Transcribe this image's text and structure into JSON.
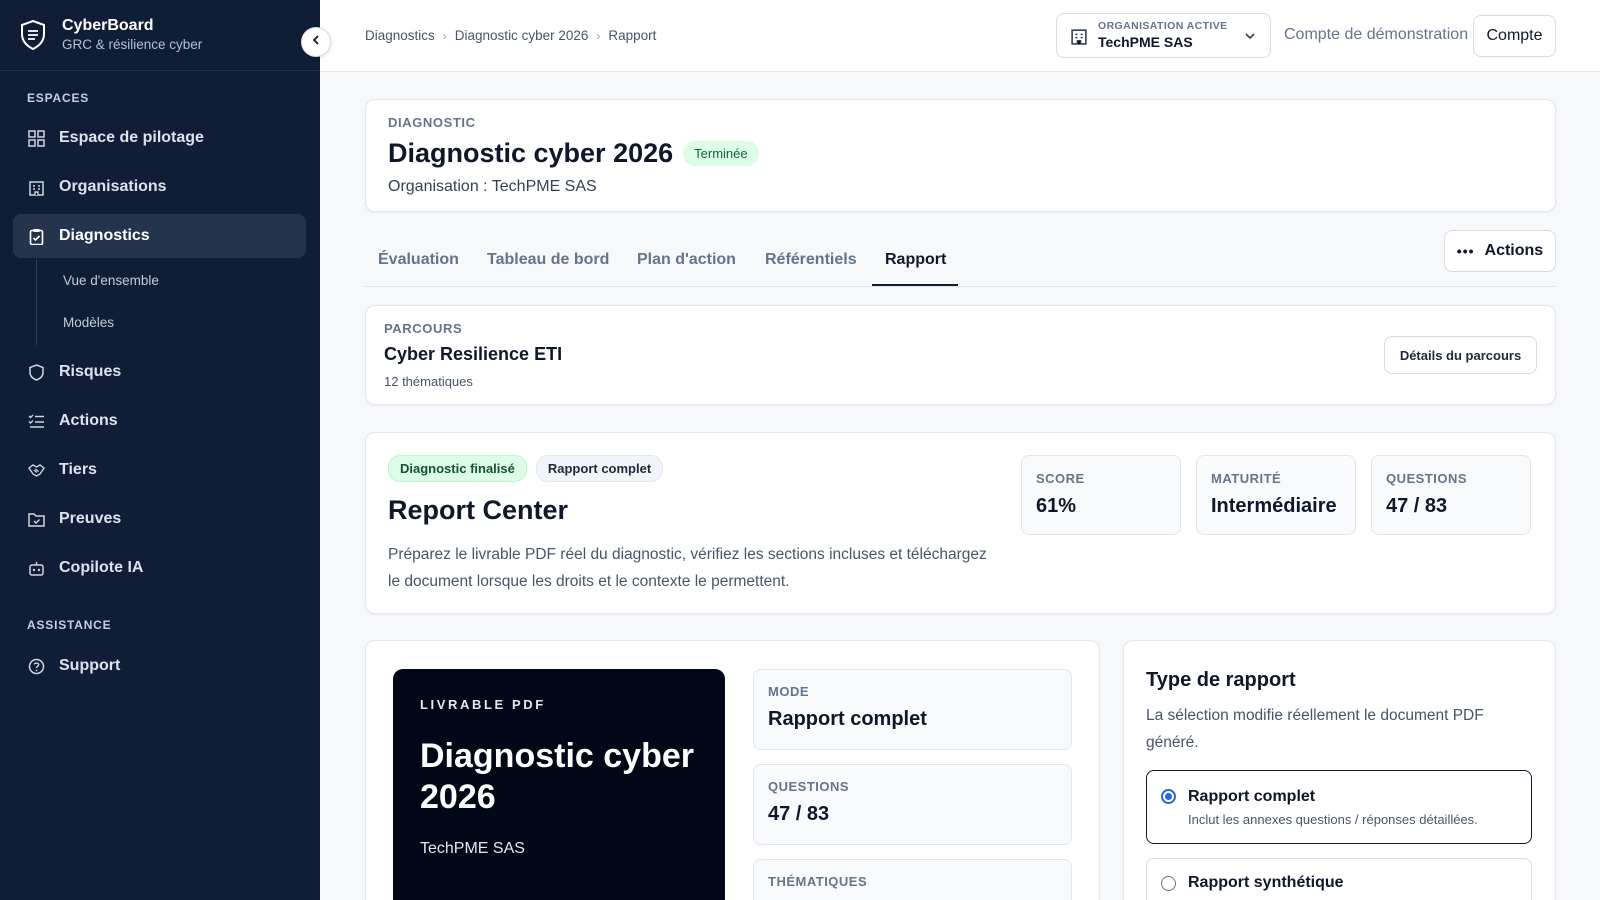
{
  "app": {
    "name": "CyberBoard",
    "tagline": "GRC & résilience cyber"
  },
  "sidebar": {
    "section_spaces": "ESPACES",
    "items": [
      {
        "label": "Espace de pilotage",
        "icon": "dashboard-icon"
      },
      {
        "label": "Organisations",
        "icon": "building-icon"
      },
      {
        "label": "Diagnostics",
        "icon": "clipboard-icon",
        "active": true
      },
      {
        "label": "Risques",
        "icon": "shield-icon"
      },
      {
        "label": "Actions",
        "icon": "checklist-icon"
      },
      {
        "label": "Tiers",
        "icon": "handshake-icon"
      },
      {
        "label": "Preuves",
        "icon": "folder-check-icon"
      },
      {
        "label": "Copilote IA",
        "icon": "bot-icon"
      }
    ],
    "subitems": [
      "Vue d'ensemble",
      "Modèles"
    ],
    "section_assistance": "ASSISTANCE",
    "support": "Support"
  },
  "topbar": {
    "breadcrumb": [
      "Diagnostics",
      "Diagnostic cyber 2026",
      "Rapport"
    ],
    "org_label": "ORGANISATION ACTIVE",
    "org_value": "TechPME SAS",
    "demo": "Compte de démonstration",
    "account": "Compte"
  },
  "header": {
    "overline": "DIAGNOSTIC",
    "title": "Diagnostic cyber 2026",
    "status": "Terminée",
    "organisation": "Organisation : TechPME SAS"
  },
  "tabs": [
    "Évaluation",
    "Tableau de bord",
    "Plan d'action",
    "Référentiels",
    "Rapport"
  ],
  "actions_label": "Actions",
  "parcours": {
    "overline": "PARCOURS",
    "name": "Cyber Resilience ETI",
    "count": "12 thématiques",
    "details_button": "Détails du parcours"
  },
  "report_center": {
    "badge_final": "Diagnostic finalisé",
    "badge_complete": "Rapport complet",
    "title": "Report Center",
    "description_line1": "Préparez le livrable PDF réel du diagnostic, vérifiez les sections incluses et téléchargez",
    "description_line2": "le document lorsque les droits et le contexte le permettent.",
    "stats": [
      {
        "label": "SCORE",
        "value": "61%"
      },
      {
        "label": "MATURITÉ",
        "value": "Intermédiaire"
      },
      {
        "label": "QUESTIONS",
        "value": "47 / 83"
      }
    ]
  },
  "pdf": {
    "overline": "LIVRABLE PDF",
    "title_line1": "Diagnostic cyber",
    "title_line2": "2026",
    "org": "TechPME SAS",
    "mode_label": "MODE",
    "mode_value": "Rapport complet",
    "questions_label": "QUESTIONS",
    "questions_value": "47 / 83",
    "themes_label": "THÉMATIQUES"
  },
  "report_type": {
    "title": "Type de rapport",
    "desc_line1": "La sélection modifie réellement le document PDF",
    "desc_line2": "généré.",
    "options": [
      {
        "label": "Rapport complet",
        "desc": "Inclut les annexes questions / réponses détaillées.",
        "selected": true
      },
      {
        "label": "Rapport synthétique",
        "desc": "",
        "selected": false
      }
    ]
  },
  "colors": {
    "sidebar": "#0f1e36",
    "accent": "#2563eb",
    "success_bg": "#dcfce7",
    "success_text": "#166534"
  }
}
